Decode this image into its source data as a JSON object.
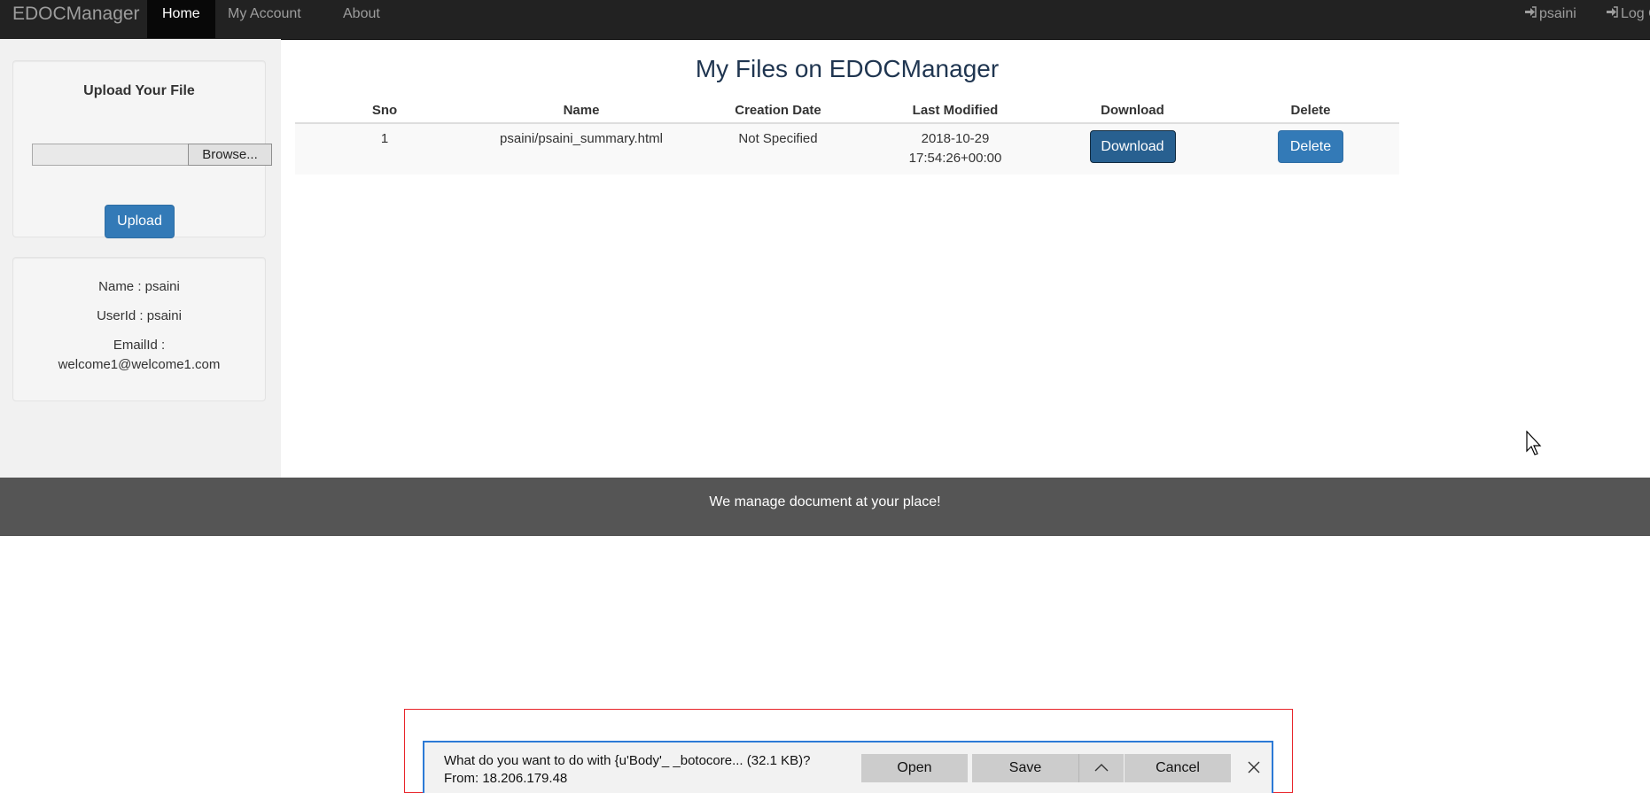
{
  "navbar": {
    "brand": "EDOCManager",
    "items": [
      {
        "label": "Home"
      },
      {
        "label": "My Account"
      },
      {
        "label": "About"
      }
    ],
    "user_label": "psaini",
    "logout_label": "Log O",
    "user_icon": "sign-in-icon",
    "logout_icon": "sign-in-icon"
  },
  "upload_panel": {
    "title": "Upload Your File",
    "file_value": "",
    "browse_label": "Browse...",
    "upload_label": "Upload"
  },
  "user_panel": {
    "name_line": "Name : psaini",
    "userid_line": "UserId : psaini",
    "email_label": "EmailId :",
    "email_value": "welcome1@welcome1.com"
  },
  "main": {
    "title": "My Files on EDOCManager",
    "columns": [
      "Sno",
      "Name",
      "Creation Date",
      "Last Modified",
      "Download",
      "Delete"
    ],
    "rows": [
      {
        "sno": "1",
        "name": "psaini/psaini_summary.html",
        "creation_date": "Not Specified",
        "last_modified_date": "2018-10-29",
        "last_modified_time": "17:54:26+00:00",
        "download_label": "Download",
        "delete_label": "Delete"
      }
    ]
  },
  "footer": {
    "text": "We manage document at your place!"
  },
  "download_bar": {
    "question": "What do you want to do with {u'Body'_ _botocore... (32.1 KB)?",
    "from": "From: 18.206.179.48",
    "open_label": "Open",
    "save_label": "Save",
    "cancel_label": "Cancel",
    "save_options_icon": "chevron-up-icon",
    "close_icon": "close-icon"
  },
  "colors": {
    "navbar_bg": "#222222",
    "primary_button": "#337ab7",
    "footer_bg": "#555555",
    "highlight_outline": "#e8242a",
    "download_bar_border": "#2c7ad6"
  }
}
